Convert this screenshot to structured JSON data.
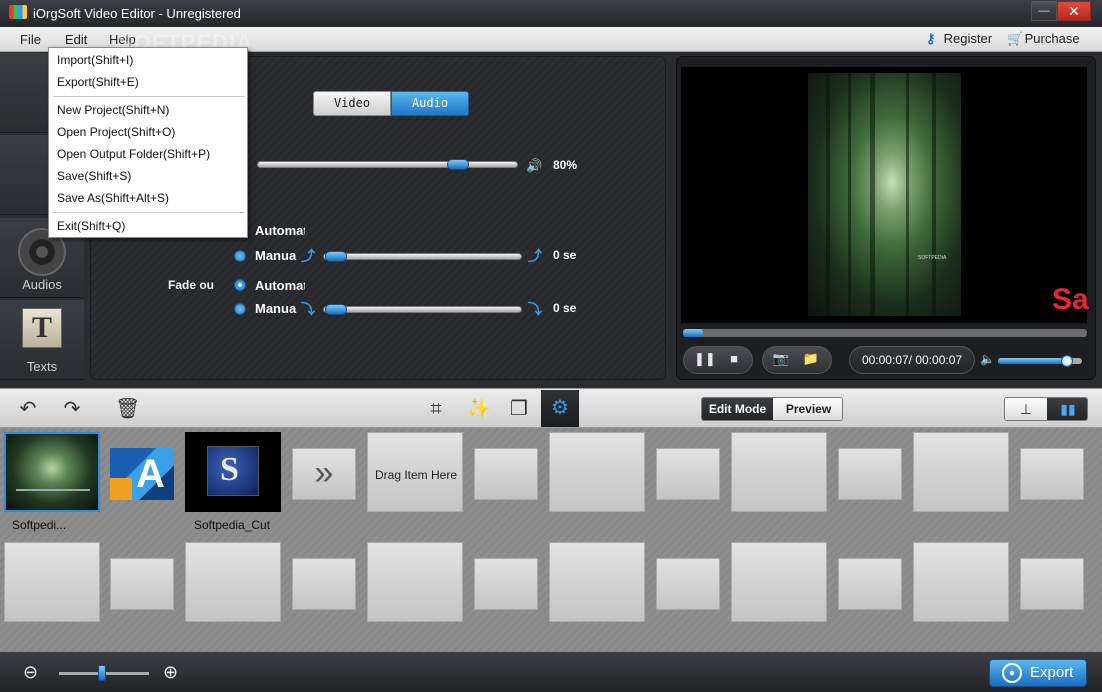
{
  "window": {
    "title": "iOrgSoft Video Editor - Unregistered",
    "minimize": "—",
    "close": "✕"
  },
  "menubar": {
    "file": "File",
    "edit": "Edit",
    "help": "Help",
    "register": "Register",
    "purchase": "Purchase",
    "watermark": "SOFTPEDIA"
  },
  "file_menu": {
    "items": [
      "Import(Shift+I)",
      "Export(Shift+E)",
      "New Project(Shift+N)",
      "Open Project(Shift+O)",
      "Open Output Folder(Shift+P)",
      "Save(Shift+S)",
      "Save As(Shift+Alt+S)",
      "Exit(Shift+Q)"
    ]
  },
  "sidebar": {
    "items": [
      {
        "label": "Audios",
        "icon": "disc-icon"
      },
      {
        "label": "Texts",
        "icon": "text-icon"
      }
    ]
  },
  "settings": {
    "tabs": {
      "video": "Video",
      "audio": "Audio",
      "selected": "Audio"
    },
    "volume": {
      "value": 0.8,
      "label": "80%"
    },
    "fade_in": {
      "automatic": "Automat",
      "manual": "Manua",
      "value": "0 se",
      "selected": "automatic",
      "level": 0
    },
    "fade_out": {
      "label": "Fade ou",
      "automatic": "Automat",
      "manual": "Manua",
      "value": "0 se",
      "selected": "automatic",
      "level": 0
    }
  },
  "preview": {
    "time": "00:00:07/ 00:00:07",
    "progress": 0.05,
    "volume": 0.82,
    "frame_caption": "SOFTPEDIA",
    "watermark": "Sa"
  },
  "toolbar": {
    "edit_mode": "Edit Mode",
    "preview_mode": "Preview",
    "active_mode": "Edit Mode"
  },
  "timeline": {
    "clips": [
      {
        "label": "Softpedi..."
      },
      {
        "label": ""
      },
      {
        "label": "Softpedia_Cut"
      }
    ],
    "drag_hint": "Drag Item Here",
    "more_glyph": "»"
  },
  "bottom": {
    "zoom": 0.48,
    "export": "Export"
  },
  "colors": {
    "accent": "#1e78c8",
    "accent_light": "#5bb6f0",
    "watermark_red": "#e8262e"
  }
}
